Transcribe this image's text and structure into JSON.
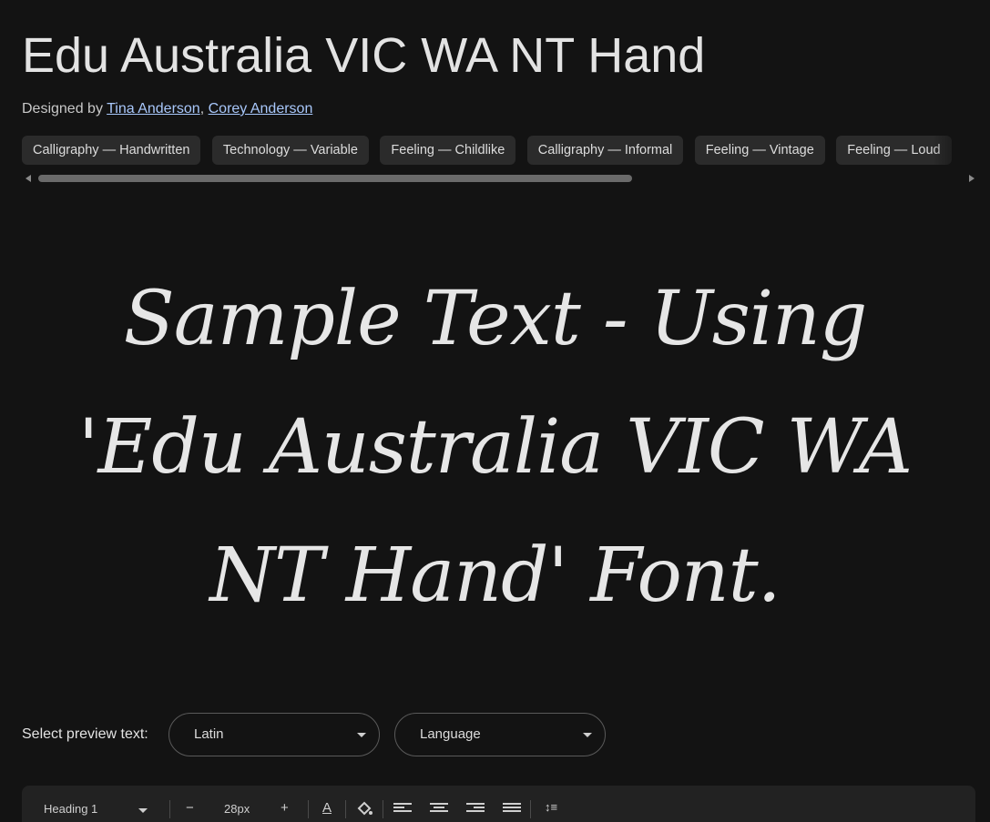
{
  "font": {
    "title": "Edu Australia VIC WA NT Hand",
    "designed_by_label": "Designed by",
    "designer_separator": ",",
    "designers": [
      "Tina Anderson",
      "Corey Anderson"
    ]
  },
  "tags": [
    "Calligraphy — Handwritten",
    "Technology — Variable",
    "Feeling — Childlike",
    "Calligraphy — Informal",
    "Feeling — Vintage",
    "Feeling — Loud"
  ],
  "sample": {
    "text": "Sample Text - Using 'Edu Australia VIC WA NT Hand' Font."
  },
  "preview": {
    "label": "Select preview text:",
    "script_value": "Latin",
    "language_value": "Language"
  },
  "toolbar": {
    "style_value": "Heading 1",
    "minus": "−",
    "font_size": "28px",
    "plus": "+",
    "text_color_glyph": "A",
    "line_height_glyph": "↕≡"
  },
  "colors": {
    "background": "#131313",
    "link": "#a8c7fa",
    "chip": "#2b2b2b"
  }
}
